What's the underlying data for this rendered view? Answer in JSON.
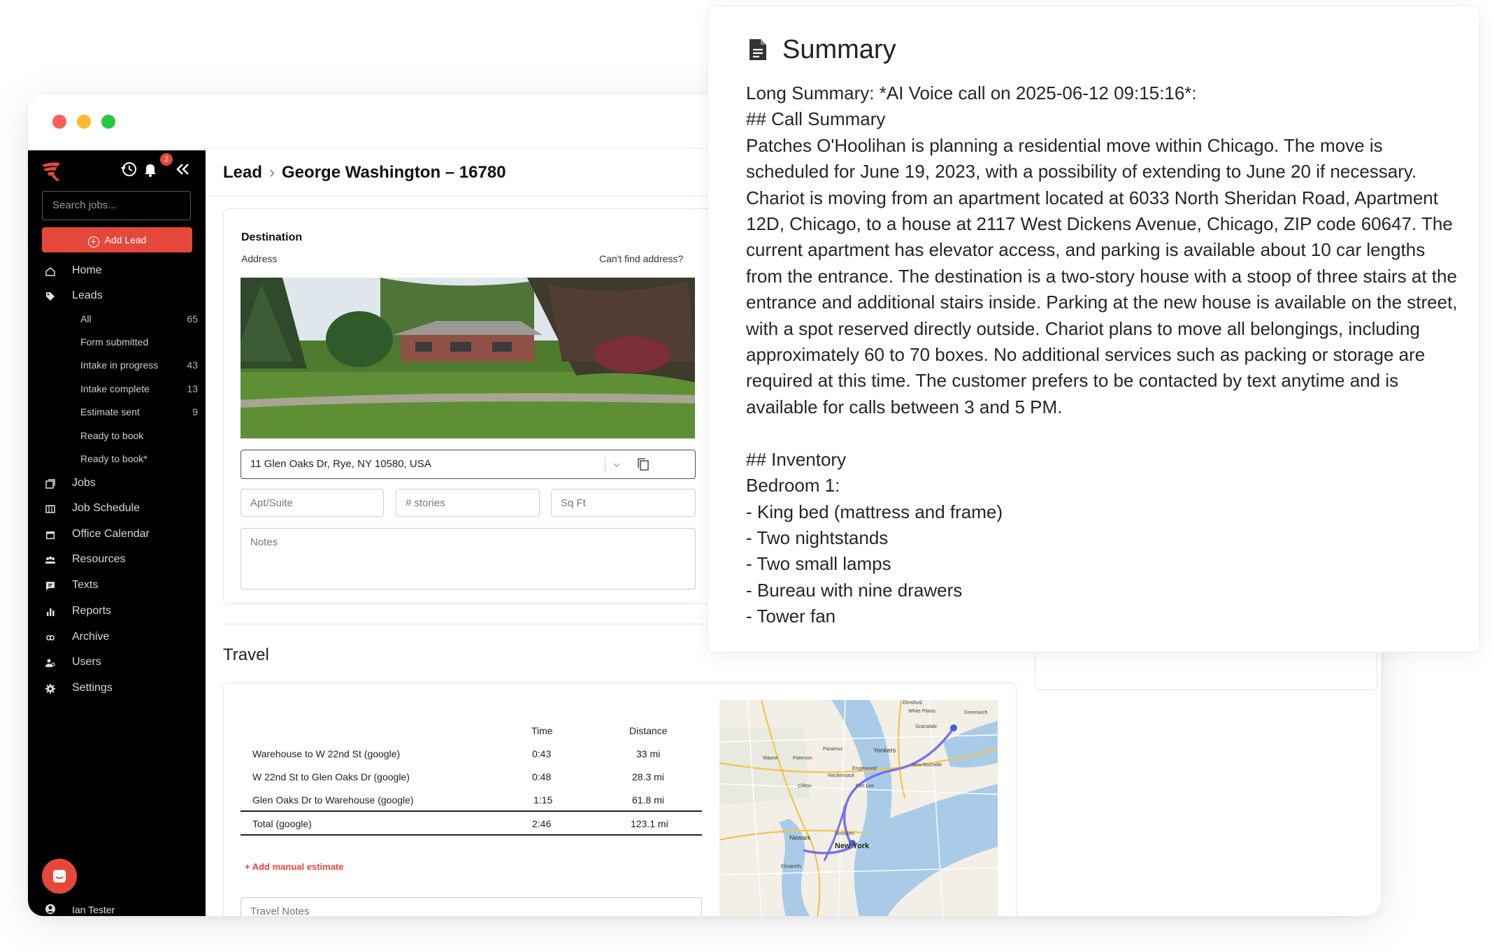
{
  "sidebar": {
    "search_placeholder": "Search jobs...",
    "notification_count": "2",
    "add_lead_label": "Add Lead",
    "nav": [
      {
        "label": "Home"
      },
      {
        "label": "Leads"
      },
      {
        "label": "Jobs"
      },
      {
        "label": "Job Schedule"
      },
      {
        "label": "Office Calendar"
      },
      {
        "label": "Resources"
      },
      {
        "label": "Texts"
      },
      {
        "label": "Reports"
      },
      {
        "label": "Archive"
      },
      {
        "label": "Users"
      },
      {
        "label": "Settings"
      }
    ],
    "lead_filters": [
      {
        "label": "All",
        "count": "65"
      },
      {
        "label": "Form submitted",
        "count": ""
      },
      {
        "label": "Intake in progress",
        "count": "43"
      },
      {
        "label": "Intake complete",
        "count": "13"
      },
      {
        "label": "Estimate sent",
        "count": "9"
      },
      {
        "label": "Ready to book",
        "count": ""
      },
      {
        "label": "Ready to book*",
        "count": ""
      }
    ],
    "user_name": "Ian Tester"
  },
  "breadcrumb": {
    "root": "Lead",
    "current": "George Washington – 16780"
  },
  "destination": {
    "title": "Destination",
    "address_label": "Address",
    "cant_find": "Can't find address?",
    "address_value": "11 Glen Oaks Dr, Rye, NY 10580, USA",
    "apt_placeholder": "Apt/Suite",
    "stories_placeholder": "# stories",
    "sqft_placeholder": "Sq Ft",
    "notes_placeholder": "Notes"
  },
  "travel": {
    "title": "Travel",
    "headers": {
      "time": "Time",
      "distance": "Distance"
    },
    "rows": [
      {
        "route": "Warehouse to W 22nd St (google)",
        "time": "0:43",
        "distance": "33 mi"
      },
      {
        "route": "W 22nd St to Glen Oaks Dr (google)",
        "time": "0:48",
        "distance": "28.3 mi"
      },
      {
        "route": "Glen Oaks Dr to Warehouse (google)",
        "time": "1:15",
        "distance": "61.8 mi"
      }
    ],
    "total": {
      "route": "Total (google)",
      "time": "2:46",
      "distance": "123.1 mi"
    },
    "manual_estimate": "+ Add manual estimate",
    "notes_placeholder": "Travel Notes"
  },
  "map": {
    "labels": {
      "yonkers": "Yonkers",
      "new_york": "New York",
      "newark": "Newark",
      "paterson": "Paterson",
      "white_plains": "White Plains",
      "hoboken": "Hoboken",
      "fort_lee": "Fort Lee",
      "elizabeth": "Elizabeth",
      "new_rochelle": "New Rochelle",
      "englewood": "Englewood",
      "hackensack": "Hackensack",
      "clifton": "Clifton",
      "scarsdale": "Scarsdale",
      "greenwich": "Greenwich",
      "wayne": "Wayne",
      "paramus": "Paramus",
      "elmsford": "Elmsford"
    }
  },
  "summary": {
    "title": "Summary",
    "text": "Long Summary: *AI Voice call on 2025-06-12 09:15:16*:\n## Call Summary\nPatches O'Hoolihan is planning a residential move within Chicago. The move is scheduled for June 19, 2023, with a possibility of extending to June 20 if necessary. Chariot is moving from an apartment located at 6033 North Sheridan Road, Apartment 12D, Chicago, to a house at 2117 West Dickens Avenue, Chicago, ZIP code 60647. The current apartment has elevator access, and parking is available about 10 car lengths from the entrance. The destination is a two-story house with a stoop of three stairs at the entrance and additional stairs inside. Parking at the new house is available on the street, with a spot reserved directly outside. Chariot plans to move all belongings, including approximately 60 to 70 boxes. No additional services such as packing or storage are required at this time. The customer prefers to be contacted by text anytime and is available for calls between 3 and 5 PM.\n\n## Inventory\nBedroom 1:\n- King bed (mattress and frame)\n- Two nightstands\n- Two small lamps\n- Bureau with nine drawers\n- Tower fan"
  },
  "colors": {
    "accent": "#e5483b",
    "sidebar_bg": "#000000"
  }
}
